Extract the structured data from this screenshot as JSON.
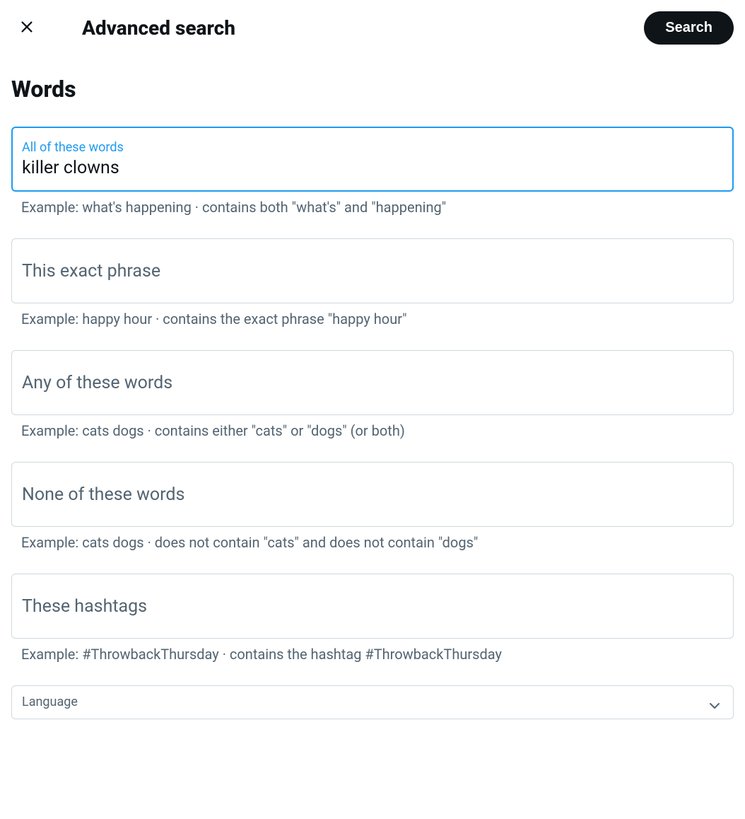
{
  "header": {
    "title": "Advanced search",
    "search_button": "Search"
  },
  "section": {
    "title": "Words"
  },
  "fields": {
    "all_words": {
      "label": "All of these words",
      "value": "killer clowns",
      "helper": "Example: what's happening · contains both \"what's\" and \"happening\""
    },
    "exact_phrase": {
      "label": "This exact phrase",
      "value": "",
      "helper": "Example: happy hour · contains the exact phrase \"happy hour\""
    },
    "any_words": {
      "label": "Any of these words",
      "value": "",
      "helper": "Example: cats dogs · contains either \"cats\" or \"dogs\" (or both)"
    },
    "none_words": {
      "label": "None of these words",
      "value": "",
      "helper": "Example: cats dogs · does not contain \"cats\" and does not contain \"dogs\""
    },
    "hashtags": {
      "label": "These hashtags",
      "value": "",
      "helper": "Example: #ThrowbackThursday · contains the hashtag #ThrowbackThursday"
    },
    "language": {
      "label": "Language"
    }
  }
}
